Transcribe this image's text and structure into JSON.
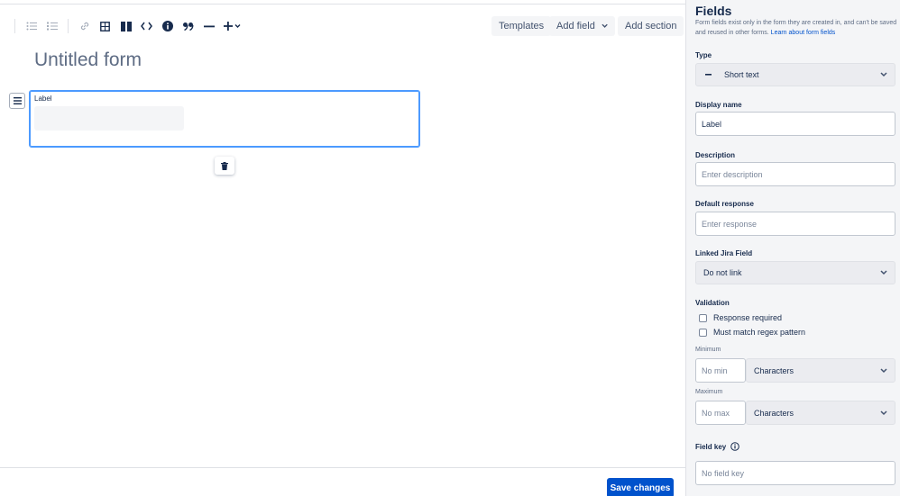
{
  "toolbar": {
    "icons": [
      "bullet-list-icon",
      "numbered-list-icon",
      "link-icon",
      "table-icon",
      "layout-icon",
      "code-icon",
      "info-icon",
      "quote-icon",
      "divider-icon",
      "insert-icon"
    ],
    "templates_label": "Templates",
    "add_field_label": "Add field",
    "add_section_label": "Add section"
  },
  "form": {
    "title": "Untitled form",
    "field_label": "Label"
  },
  "footer": {
    "save_label": "Save changes"
  },
  "panel": {
    "title": "Fields",
    "description": "Form fields exist only in the form they are created in, and can't be saved and reused in other forms.",
    "learn_more": "Learn about form fields",
    "type_label": "Type",
    "type_value": "Short text",
    "display_name_label": "Display name",
    "display_name_value": "Label",
    "description_label": "Description",
    "description_placeholder": "Enter description",
    "default_response_label": "Default response",
    "default_response_placeholder": "Enter response",
    "linked_jira_label": "Linked Jira Field",
    "linked_jira_value": "Do not link",
    "validation_label": "Validation",
    "response_required_label": "Response required",
    "regex_label": "Must match regex pattern",
    "minimum_label": "Minimum",
    "min_placeholder": "No min",
    "min_unit": "Characters",
    "maximum_label": "Maximum",
    "max_placeholder": "No max",
    "max_unit": "Characters",
    "field_key_label": "Field key",
    "field_key_placeholder": "No field key"
  },
  "colors": {
    "primary": "#0052CC",
    "focus": "#4C9AFF",
    "text": "#172B4D",
    "subtle": "#5E6C84",
    "panel_bg": "#F4F5F7"
  }
}
